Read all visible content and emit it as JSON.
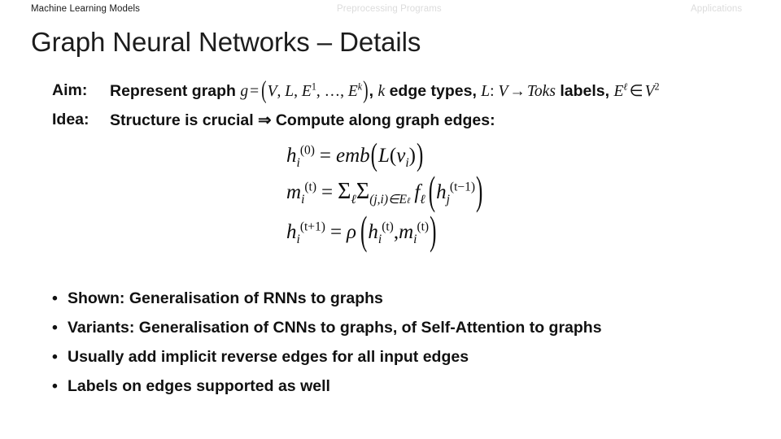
{
  "nav": {
    "items": [
      {
        "label": "Machine Learning Models",
        "state": "active"
      },
      {
        "label": "Preprocessing Programs",
        "state": "dim"
      },
      {
        "label": "Applications",
        "state": "dim"
      }
    ]
  },
  "slide": {
    "title": "Graph Neural Networks – Details"
  },
  "definitions": [
    {
      "label": "Aim:",
      "text_plain": "Represent graph g = (V, L, E¹, …, Eᵏ), k edge types, L: V → Toks labels, Eℓ ∈ V²",
      "lead": "Represent graph ",
      "var_g": "g",
      "eq": "=",
      "open_paren": "(",
      "set_v": "V",
      "comma1": ", ",
      "set_l": "L",
      "comma2": ", ",
      "set_e1": "E",
      "sup_1": "1",
      "ellipsis": ", …, ",
      "set_ek": "E",
      "sup_k": "k",
      "close_paren": ")",
      "mid1": ", ",
      "var_k": "k",
      "mid2": " edge types, ",
      "map_l": "L",
      "colon": ": ",
      "map_v": "V",
      "arrow": "→",
      "toks": "Toks",
      "labels_word": " labels, ",
      "set_e_l": "E",
      "sup_ell": "ℓ",
      "in_sym": "∈",
      "set_v2": "V",
      "sup_2": "2"
    },
    {
      "label": "Idea:",
      "text_plain": "Structure is crucial ⇒ Compute along graph edges:",
      "part_a": "Structure is crucial ",
      "implies": "⇒",
      "part_b": " Compute along graph edges:"
    }
  ],
  "equations": [
    {
      "id": "eq-init",
      "plain": "h_i^(0) = emb(L(v_i))",
      "lhs_var": "h",
      "lhs_sub": "i",
      "lhs_sup": "(0)",
      "eq": "=",
      "fn": "emb",
      "open": "(",
      "inner_fn": "L",
      "inner_open": "(",
      "inner_var": "v",
      "inner_sub": "i",
      "inner_close": ")",
      "close": ")"
    },
    {
      "id": "eq-message",
      "plain": "m_i^(t) = Σ_ℓ Σ_{(j,i)∈E^ℓ} f_ℓ ( h_j^(t−1) )",
      "lhs_var": "m",
      "lhs_sub": "i",
      "lhs_sup": "(t)",
      "eq": "=",
      "sum1": "Σ",
      "sum1_sub": "ℓ",
      "sum2": "Σ",
      "sum2_sub": "(j,i)∈E",
      "sum2_sub_sup": "ℓ",
      "fn": "f",
      "fn_sub": "ℓ",
      "open": "(",
      "arg_var": "h",
      "arg_sub": "j",
      "arg_sup": "(t−1)",
      "close": ")"
    },
    {
      "id": "eq-update",
      "plain": "h_i^(t+1) = ρ( h_i^(t), m_i^(t) )",
      "lhs_var": "h",
      "lhs_sub": "i",
      "lhs_sup": "(t+1)",
      "eq": "=",
      "fn": "ρ",
      "open": "(",
      "a_var": "h",
      "a_sub": "i",
      "a_sup": "(t)",
      "comma": ",",
      "b_var": "m",
      "b_sub": "i",
      "b_sup": "(t)",
      "close": ")"
    }
  ],
  "bullets": {
    "marker": "•",
    "items": [
      "Shown: Generalisation of RNNs to graphs",
      "Variants: Generalisation of CNNs to graphs, of Self-Attention to graphs",
      "Usually add implicit reverse edges for all input edges",
      "Labels on edges supported as well"
    ]
  },
  "colors": {
    "background": "#ffffff",
    "text": "#111111",
    "title": "#1c1c1c",
    "nav_active": "#1a1a1a",
    "nav_dim": "#dcdcdc"
  }
}
